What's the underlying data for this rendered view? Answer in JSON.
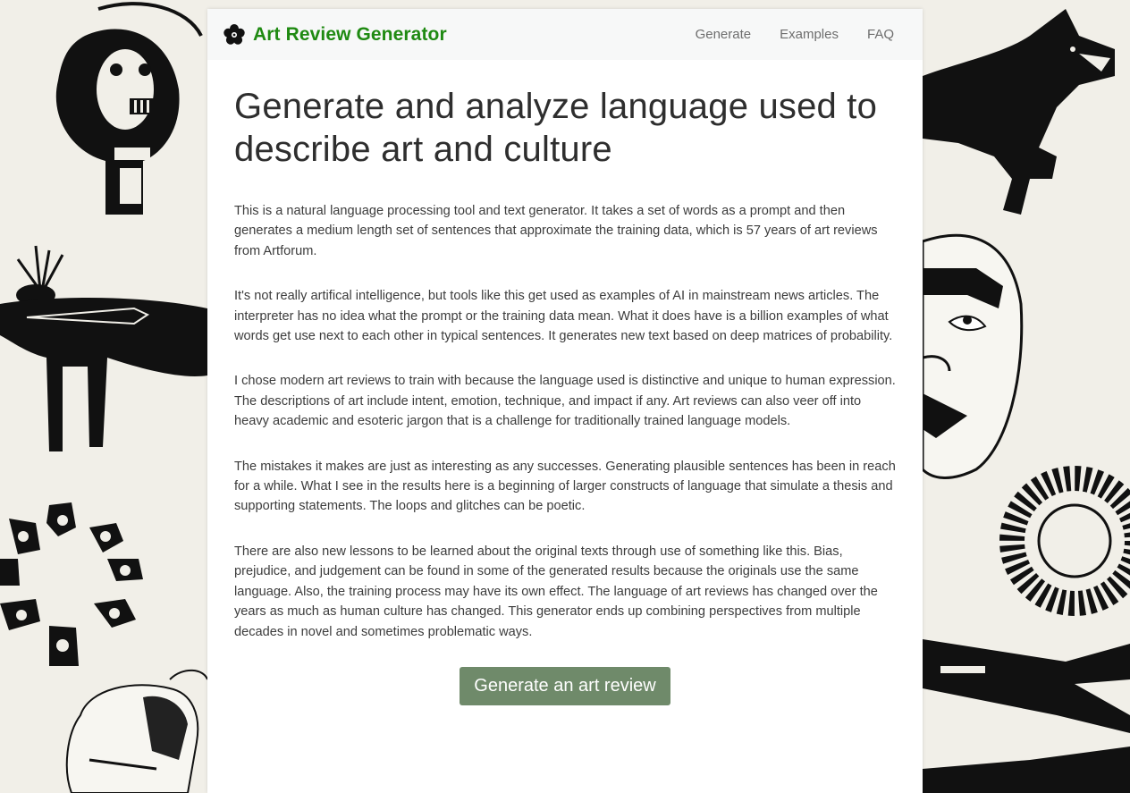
{
  "header": {
    "brand": "Art Review Generator",
    "nav": [
      {
        "label": "Generate"
      },
      {
        "label": "Examples"
      },
      {
        "label": "FAQ"
      }
    ]
  },
  "main": {
    "title": "Generate and analyze language used to describe art and culture",
    "paragraphs": [
      "This is a natural language processing tool and text generator. It takes a set of words as a prompt and then generates a medium length set of sentences that approximate the training data, which is 57 years of art reviews from Artforum.",
      "It's not really artifical intelligence, but tools like this get used as examples of AI in mainstream news articles. The interpreter has no idea what the prompt or the training data mean. What it does have is a billion examples of what words get use next to each other in typical sentences. It generates new text based on deep matrices of probability.",
      "I chose modern art reviews to train with because the language used is distinctive and unique to human expression. The descriptions of art include intent, emotion, technique, and impact if any. Art reviews can also veer off into heavy academic and esoteric jargon that is a challenge for traditionally trained language models.",
      "The mistakes it makes are just as interesting as any successes. Generating plausible sentences has been in reach for a while. What I see in the results here is a beginning of larger constructs of language that simulate a thesis and supporting statements. The loops and glitches can be poetic.",
      "There are also new lessons to be learned about the original texts through use of something like this. Bias, prejudice, and judgement can be found in some of the generated results because the originals use the same language. Also, the training process may have its own effect. The language of art reviews has changed over the years as much as human culture has changed. This generator ends up combining perspectives from multiple decades in novel and sometimes problematic ways."
    ],
    "cta_label": "Generate an art review"
  },
  "colors": {
    "brand": "#1f8a12",
    "button": "#6f8a6a",
    "background": "#f1efe8",
    "nav_text": "#6e6e6e"
  },
  "icons": {
    "brand_logo": "flower-icon"
  }
}
